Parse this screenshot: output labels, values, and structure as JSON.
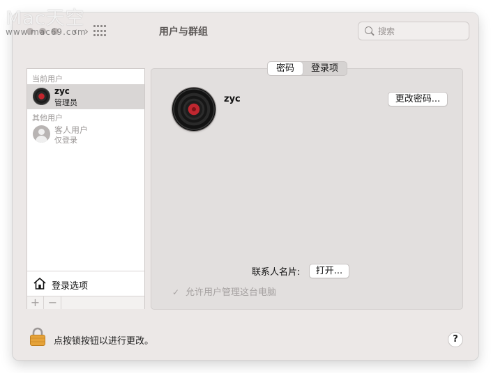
{
  "watermark": {
    "brand": "Mac天空",
    "site": "www.mac69.com"
  },
  "window": {
    "title": "用户与群组"
  },
  "search": {
    "placeholder": "搜索"
  },
  "sidebar": {
    "current_users_label": "当前用户",
    "current_user": {
      "name": "zyc",
      "role": "管理员"
    },
    "other_users_label": "其他用户",
    "guest_user": {
      "name": "客人用户",
      "role": "仅登录"
    },
    "login_options_label": "登录选项",
    "add_label": "+",
    "remove_label": "−"
  },
  "tabs": [
    {
      "label": "密码",
      "active": true
    },
    {
      "label": "登录项",
      "active": false
    }
  ],
  "profile": {
    "name": "zyc",
    "change_password_label": "更改密码...",
    "contact_card_label": "联系人名片:",
    "open_label": "打开...",
    "allow_admin_label": "允许用户管理这台电脑",
    "allow_admin_checked": true
  },
  "footer": {
    "lock_text": "点按锁按钮以进行更改。",
    "help_label": "?"
  },
  "colors": {
    "window_bg": "#ece8e7",
    "selected_row": "#d9d6d5",
    "lock_gold": "#e6a33a"
  }
}
